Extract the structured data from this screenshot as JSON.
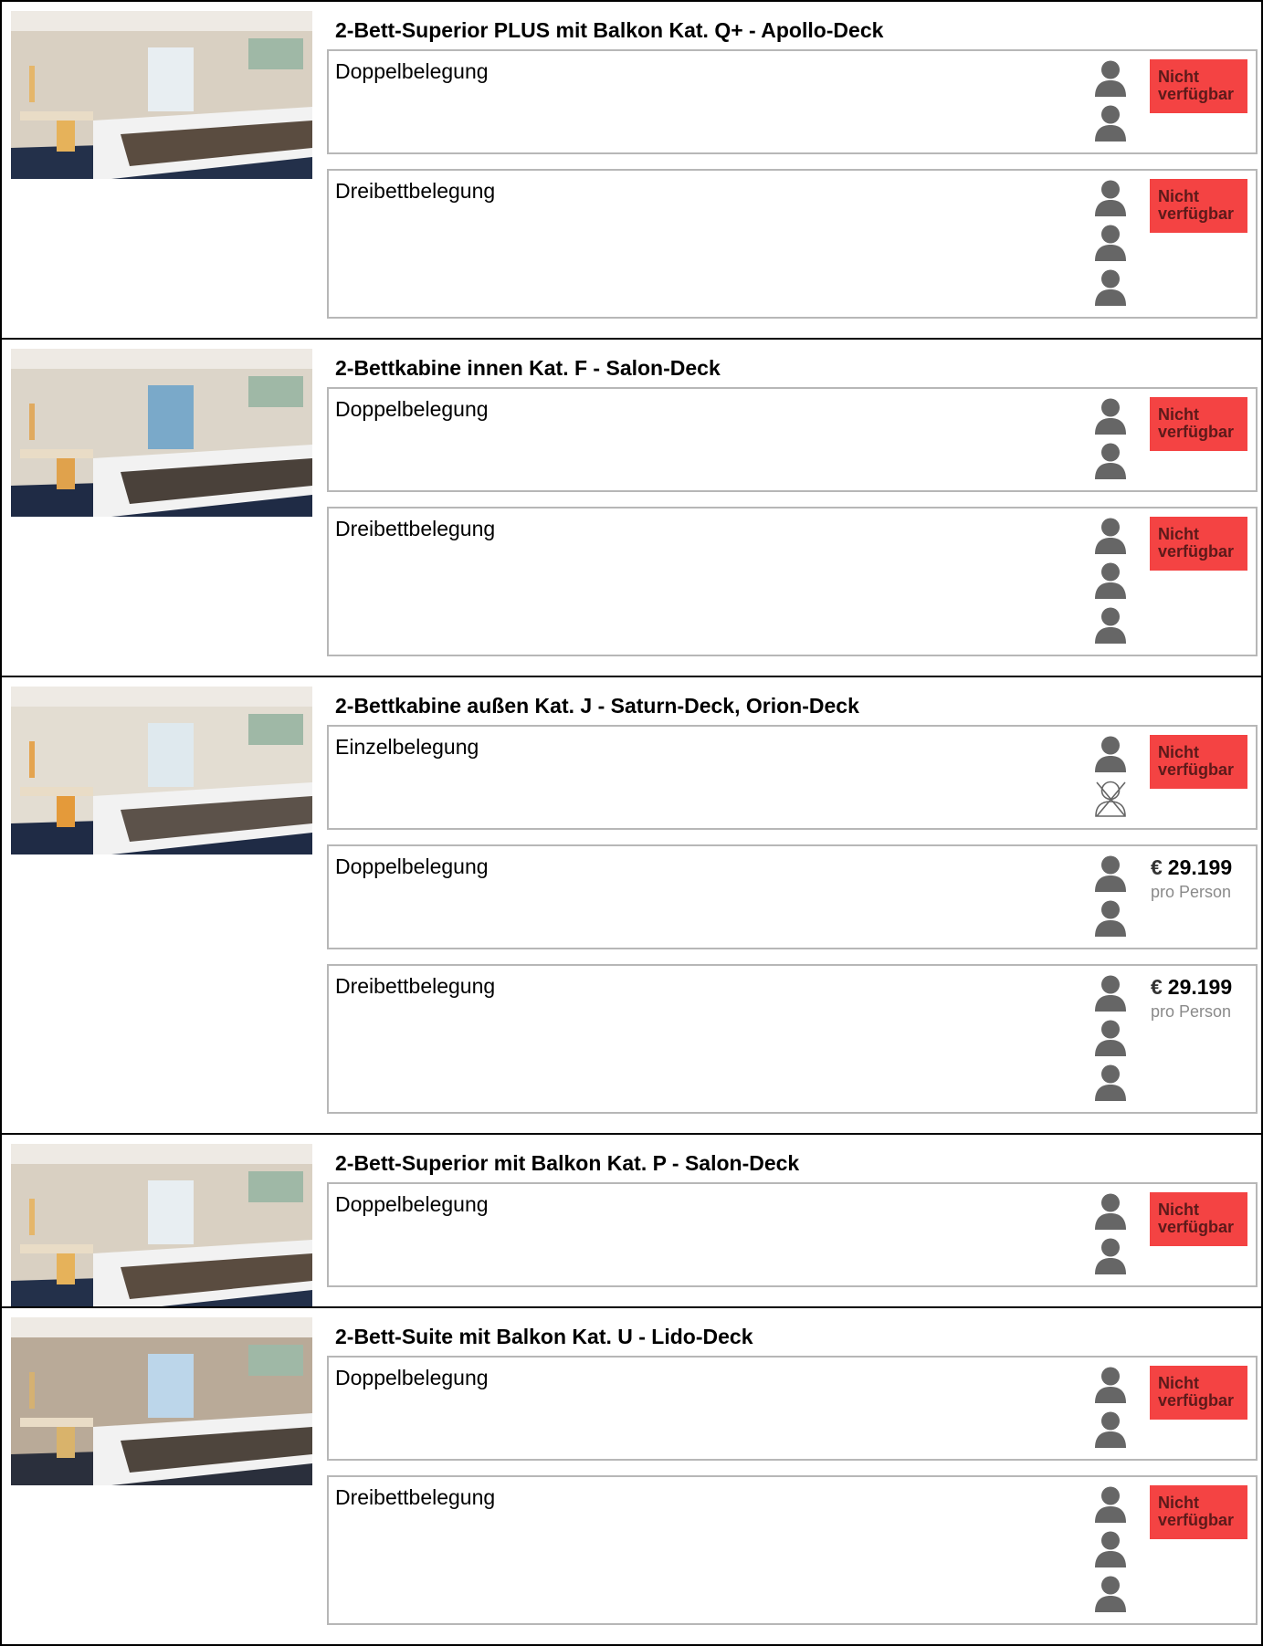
{
  "colors": {
    "unavailable_bg": "#f44343",
    "unavailable_text": "#5c1a1a",
    "person_icon": "#666666",
    "box_border": "#b7b7b7"
  },
  "cabins": [
    {
      "title": "2-Bett-Superior PLUS mit Balkon Kat. Q+ - Apollo-Deck",
      "image_icon": "cabin-balcony-photo",
      "occupancies": [
        {
          "label": "Doppelbelegung",
          "persons": 2,
          "status": "Nicht verfügbar",
          "status_line1": "Nicht",
          "status_line2": "verfügbar"
        },
        {
          "label": "Dreibettbelegung",
          "persons": 3,
          "status": "Nicht verfügbar",
          "status_line1": "Nicht",
          "status_line2": "verfügbar"
        }
      ]
    },
    {
      "title": "2-Bettkabine innen Kat. F - Salon-Deck",
      "image_icon": "cabin-inside-photo",
      "occupancies": [
        {
          "label": "Doppelbelegung",
          "persons": 2,
          "status": "Nicht verfügbar",
          "status_line1": "Nicht",
          "status_line2": "verfügbar"
        },
        {
          "label": "Dreibettbelegung",
          "persons": 3,
          "status": "Nicht verfügbar",
          "status_line1": "Nicht",
          "status_line2": "verfügbar"
        }
      ]
    },
    {
      "title": "2-Bettkabine außen Kat. J - Saturn-Deck, Orion-Deck",
      "image_icon": "cabin-outside-photo",
      "occupancies": [
        {
          "label": "Einzelbelegung",
          "persons": 1,
          "crossed_persons": 1,
          "status": "Nicht verfügbar",
          "status_line1": "Nicht",
          "status_line2": "verfügbar"
        },
        {
          "label": "Doppelbelegung",
          "persons": 2,
          "price": {
            "currency": "€",
            "amount": "29.199",
            "note": "pro Person"
          }
        },
        {
          "label": "Dreibettbelegung",
          "persons": 3,
          "price": {
            "currency": "€",
            "amount": "29.199",
            "note": "pro Person"
          }
        }
      ]
    },
    {
      "title": "2-Bett-Superior mit Balkon Kat. P - Salon-Deck",
      "image_icon": "cabin-balcony-photo",
      "occupancies": [
        {
          "label": "Doppelbelegung",
          "persons": 2,
          "status": "Nicht verfügbar",
          "status_line1": "Nicht",
          "status_line2": "verfügbar"
        }
      ]
    },
    {
      "title": "2-Bett-Suite mit Balkon Kat. U - Lido-Deck",
      "image_icon": "cabin-suite-photo",
      "occupancies": [
        {
          "label": "Doppelbelegung",
          "persons": 2,
          "status": "Nicht verfügbar",
          "status_line1": "Nicht",
          "status_line2": "verfügbar"
        },
        {
          "label": "Dreibettbelegung",
          "persons": 3,
          "status": "Nicht verfügbar",
          "status_line1": "Nicht",
          "status_line2": "verfügbar"
        }
      ]
    }
  ]
}
